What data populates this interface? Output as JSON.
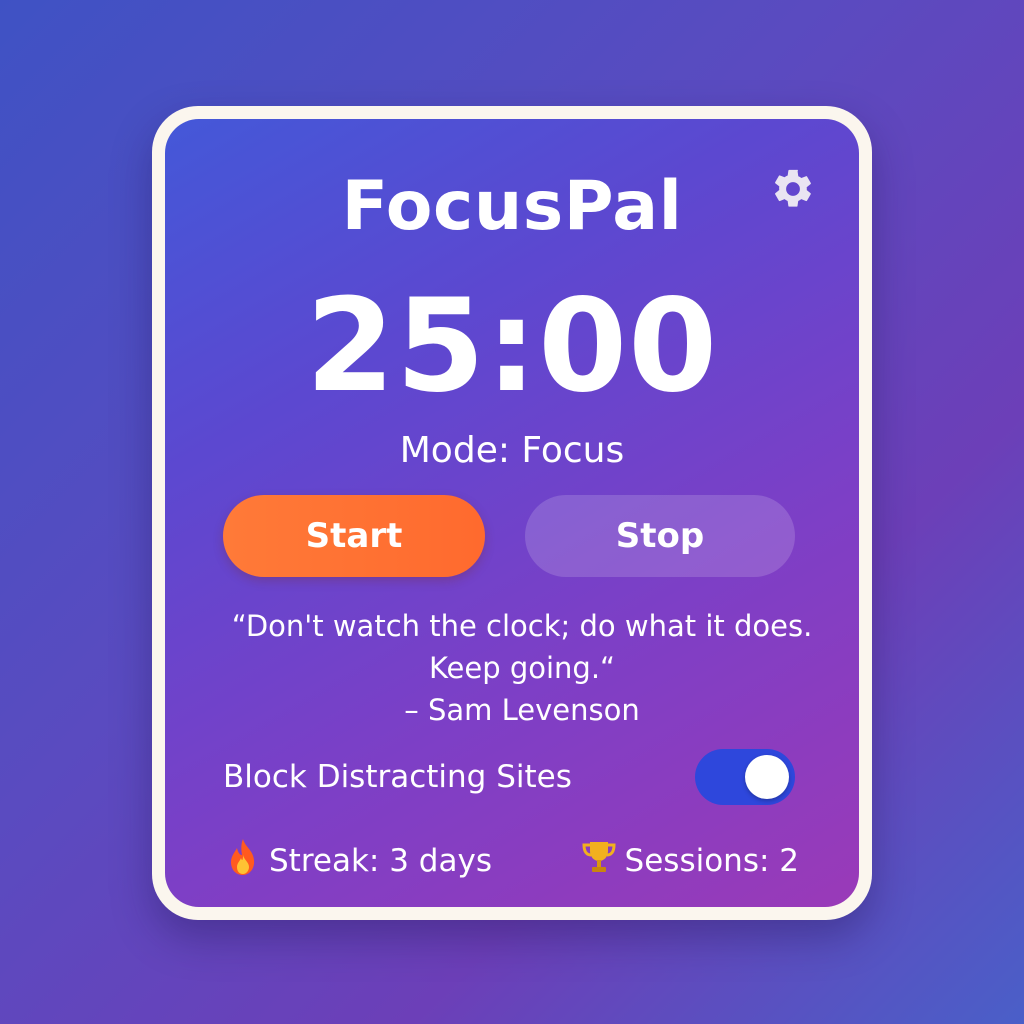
{
  "app": {
    "title": "FocusPal",
    "settings_icon": "gear-icon"
  },
  "timer": {
    "display": "25:00",
    "mode_label": "Mode: Focus"
  },
  "controls": {
    "start_label": "Start",
    "stop_label": "Stop"
  },
  "quote": {
    "line1": "“Don't watch the clock; do what it does.",
    "line2": "Keep going.“",
    "author": "– Sam Levenson"
  },
  "block_sites": {
    "label": "Block Distracting Sites",
    "enabled": true
  },
  "stats": {
    "streak_icon": "fire-icon",
    "streak_text": "Streak: 3 days",
    "sessions_icon": "trophy-icon",
    "sessions_text": "Sessions: 2"
  },
  "colors": {
    "accent_start": "#ff6a2e",
    "toggle_on": "#2e47dc",
    "panel_gradient_start": "#4458d8",
    "panel_gradient_end": "#9a3ab8",
    "frame": "#fbf6ee"
  }
}
